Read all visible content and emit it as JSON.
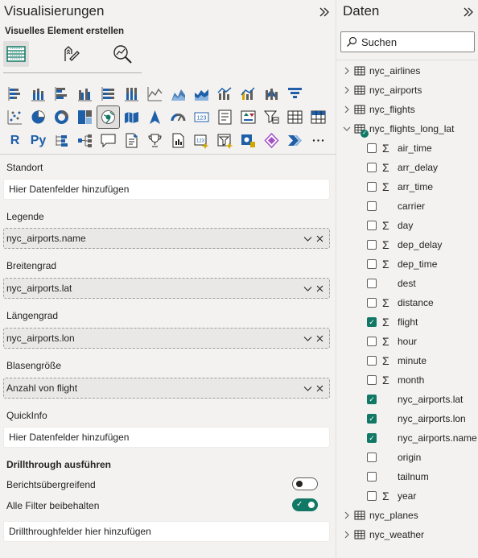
{
  "viz_pane": {
    "title": "Visualisierungen",
    "build_label": "Visuelles Element erstellen",
    "viz_text_r": "R",
    "viz_text_py": "Py",
    "wells": [
      {
        "label": "Standort",
        "value": "Hier Datenfelder hinzufügen",
        "filled": false
      },
      {
        "label": "Legende",
        "value": "nyc_airports.name",
        "filled": true
      },
      {
        "label": "Breitengrad",
        "value": "nyc_airports.lat",
        "filled": true
      },
      {
        "label": "Längengrad",
        "value": "nyc_airports.lon",
        "filled": true
      },
      {
        "label": "Blasengröße",
        "value": "Anzahl von flight",
        "filled": true
      },
      {
        "label": "QuickInfo",
        "value": "Hier Datenfelder hinzufügen",
        "filled": false
      }
    ],
    "drillthrough": {
      "header": "Drillthrough ausführen",
      "cross_report_label": "Berichtsübergreifend",
      "cross_report_on": false,
      "keep_filters_label": "Alle Filter beibehalten",
      "keep_filters_on": true,
      "fields_placeholder": "Drillthroughfelder hier hinzufügen"
    }
  },
  "data_pane": {
    "title": "Daten",
    "search_placeholder": "Suchen",
    "tables_top": [
      "nyc_airlines",
      "nyc_airports",
      "nyc_flights"
    ],
    "expanded_table": "nyc_flights_long_lat",
    "fields": [
      {
        "name": "air_time",
        "sigma": true,
        "checked": false
      },
      {
        "name": "arr_delay",
        "sigma": true,
        "checked": false
      },
      {
        "name": "arr_time",
        "sigma": true,
        "checked": false
      },
      {
        "name": "carrier",
        "sigma": false,
        "checked": false
      },
      {
        "name": "day",
        "sigma": true,
        "checked": false
      },
      {
        "name": "dep_delay",
        "sigma": true,
        "checked": false
      },
      {
        "name": "dep_time",
        "sigma": true,
        "checked": false
      },
      {
        "name": "dest",
        "sigma": false,
        "checked": false
      },
      {
        "name": "distance",
        "sigma": true,
        "checked": false
      },
      {
        "name": "flight",
        "sigma": true,
        "checked": true
      },
      {
        "name": "hour",
        "sigma": true,
        "checked": false
      },
      {
        "name": "minute",
        "sigma": true,
        "checked": false
      },
      {
        "name": "month",
        "sigma": true,
        "checked": false
      },
      {
        "name": "nyc_airports.lat",
        "sigma": false,
        "checked": true
      },
      {
        "name": "nyc_airports.lon",
        "sigma": false,
        "checked": true
      },
      {
        "name": "nyc_airports.name",
        "sigma": false,
        "checked": true
      },
      {
        "name": "origin",
        "sigma": false,
        "checked": false
      },
      {
        "name": "tailnum",
        "sigma": false,
        "checked": false
      },
      {
        "name": "year",
        "sigma": true,
        "checked": false
      }
    ],
    "tables_bottom": [
      "nyc_planes",
      "nyc_weather"
    ]
  },
  "colors": {
    "accent_green": "#117865",
    "background": "#f3f2f1"
  }
}
